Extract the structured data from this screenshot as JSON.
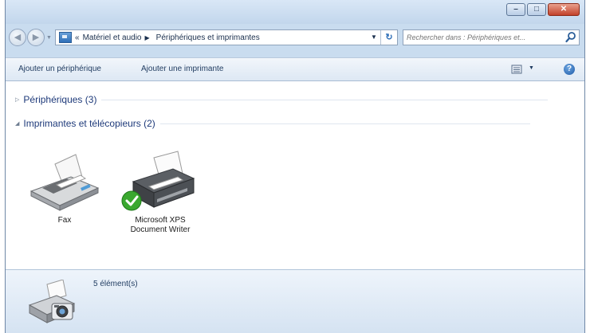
{
  "window": {
    "caption_buttons": [
      {
        "name": "minimize",
        "glyph": "–"
      },
      {
        "name": "maximize",
        "glyph": "□"
      },
      {
        "name": "close",
        "glyph": "✕"
      }
    ]
  },
  "nav": {
    "back_glyph": "◀",
    "forward_glyph": "▶",
    "history_glyph": "▼",
    "breadcrumb": [
      {
        "prefix": "«",
        "label": "Matériel et audio",
        "sep": "▶"
      },
      {
        "label": "Périphériques et imprimantes"
      }
    ],
    "address_dropdown_glyph": "▼",
    "refresh_glyph": "↻",
    "search_placeholder": "Rechercher dans : Périphériques et..."
  },
  "toolbar": {
    "add_device": "Ajouter un périphérique",
    "add_printer": "Ajouter une imprimante",
    "view_dropdown_glyph": "▼",
    "help_glyph": "?"
  },
  "groups": [
    {
      "label": "Périphériques (3)",
      "arrow": "▷",
      "expanded": false
    },
    {
      "label": "Imprimantes et télécopieurs (2)",
      "arrow": "◢",
      "expanded": true
    }
  ],
  "devices": [
    {
      "name": "Fax",
      "lines": [
        "Fax"
      ],
      "icon": "fax-icon",
      "default": false
    },
    {
      "name": "Microsoft XPS Document Writer",
      "lines": [
        "Microsoft XPS",
        "Document Writer"
      ],
      "icon": "printer-icon",
      "default": true
    }
  ],
  "status": {
    "count_text": "5 élément(s)",
    "icon": "printer-camera-icon"
  },
  "colors": {
    "link_blue": "#1e3a7a",
    "default_check": "#3aa82f",
    "close_red": "#c2412a"
  }
}
